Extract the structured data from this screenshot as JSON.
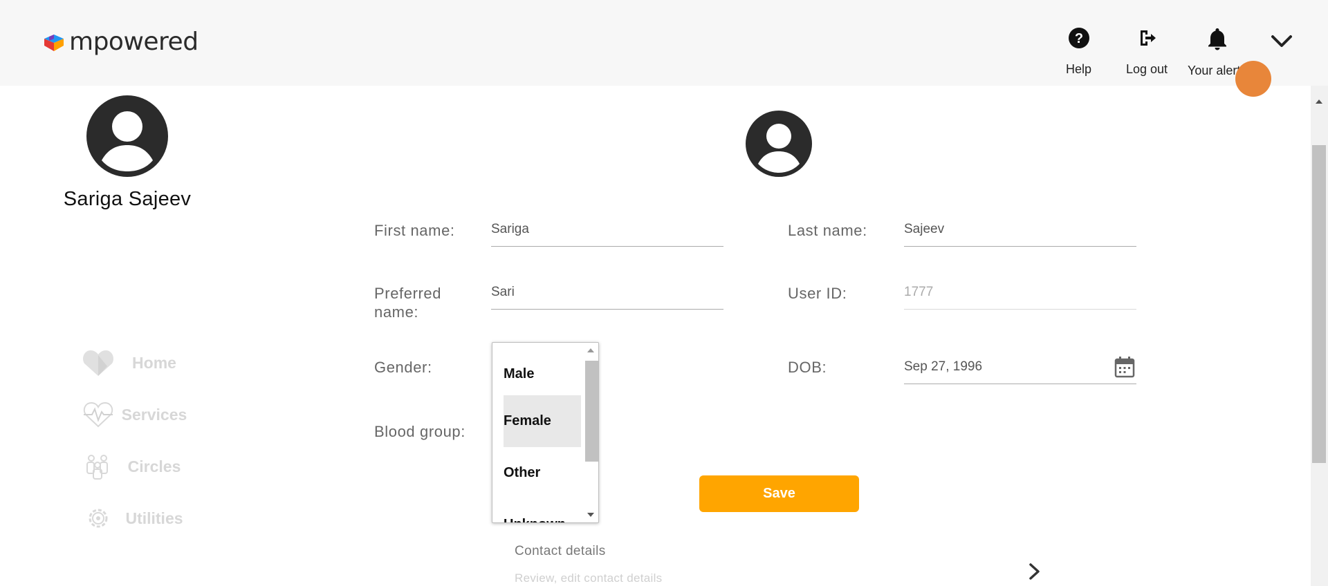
{
  "header": {
    "brand": "mpowered",
    "help_label": "Help",
    "logout_label": "Log out",
    "alerts_label": "Your alerts"
  },
  "sidebar": {
    "user_name": "Sariga Sajeev",
    "items": [
      {
        "label": "Home",
        "icon": "heart-home-icon"
      },
      {
        "label": "Services",
        "icon": "heartbeat-icon"
      },
      {
        "label": "Circles",
        "icon": "people-icon"
      },
      {
        "label": "Utilities",
        "icon": "gear-icon"
      }
    ]
  },
  "form": {
    "first_name_label": "First name:",
    "first_name_value": "Sariga",
    "last_name_label": "Last name:",
    "last_name_value": "Sajeev",
    "preferred_name_label": "Preferred name:",
    "preferred_name_value": "Sari",
    "user_id_label": "User ID:",
    "user_id_value": "1777",
    "gender_label": "Gender:",
    "dob_label": "DOB:",
    "dob_value": "Sep 27, 1996",
    "blood_group_label": "Blood group:",
    "save_label": "Save"
  },
  "gender_dropdown": {
    "options": [
      "Male",
      "Female",
      "Other",
      "Unknown"
    ],
    "selected": "Female"
  },
  "contact": {
    "title": "Contact details",
    "subtitle": "Review, edit contact details"
  },
  "colors": {
    "accent": "#ffa500",
    "header_bg": "#f7f7f7",
    "avatar": "#2b2b2b"
  }
}
